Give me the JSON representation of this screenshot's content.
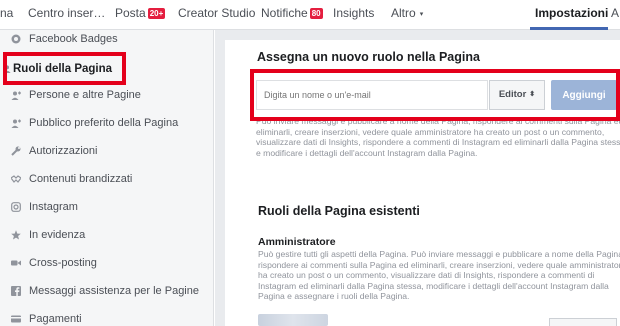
{
  "topnav": {
    "items": [
      {
        "label": "na"
      },
      {
        "label": "Centro inser…"
      },
      {
        "label": "Posta",
        "badge": "20+"
      },
      {
        "label": "Creator Studio"
      },
      {
        "label": "Notifiche",
        "badge": "80"
      },
      {
        "label": "Insights"
      },
      {
        "label": "Altro",
        "caret": "▾"
      },
      {
        "label": "Impostazioni",
        "active": true
      },
      {
        "label": "A"
      }
    ]
  },
  "sidebar": {
    "items": [
      {
        "label": "Facebook Badges",
        "icon": "badge-icon"
      },
      {
        "label": "Ruoli della Pagina",
        "icon": "person-icon",
        "selected": true
      },
      {
        "label": "Persone e altre Pagine",
        "icon": "people-icon"
      },
      {
        "label": "Pubblico preferito della Pagina",
        "icon": "people-icon"
      },
      {
        "label": "Autorizzazioni",
        "icon": "wrench-icon"
      },
      {
        "label": "Contenuti brandizzati",
        "icon": "handshake-icon"
      },
      {
        "label": "Instagram",
        "icon": "instagram-icon"
      },
      {
        "label": "In evidenza",
        "icon": "star-icon"
      },
      {
        "label": "Cross-posting",
        "icon": "video-icon"
      },
      {
        "label": "Messaggi assistenza per le Pagine",
        "icon": "facebook-icon"
      },
      {
        "label": "Pagamenti",
        "icon": "payment-icon"
      }
    ]
  },
  "assign": {
    "title": "Assegna un nuovo ruolo nella Pagina",
    "input_placeholder": "Digita un nome o un'e-mail",
    "role_value": "Editor",
    "role_arrow": "⬍",
    "add_label": "Aggiungi",
    "description_lines": [
      "Può inviare messaggi e pubblicare a nome della Pagina, rispondere ai commenti sulla Pagina ed",
      "eliminarli, creare inserzioni, vedere quale amministratore ha creato un post o un commento,",
      "visualizzare dati di Insights, rispondere a commenti di Instagram ed eliminarli dalla Pagina stessa",
      "e modificare i dettagli dell'account Instagram dalla Pagina."
    ]
  },
  "existing": {
    "title": "Ruoli della Pagina esistenti",
    "admin_heading": "Amministratore",
    "admin_description_lines": [
      "Può gestire tutti gli aspetti della Pagina. Può inviare messaggi e pubblicare a nome della Pagina,",
      "rispondere ai commenti sulla Pagina ed eliminarli, creare inserzioni, vedere quale amministratore",
      "ha creato un post o un commento, visualizzare dati di Insights, rispondere a commenti di",
      "Instagram ed eliminarli dalla Pagina stessa, modificare i dettagli dell'account Instagram dalla",
      "Pagina e assegnare i ruoli della Pagina."
    ]
  },
  "colors": {
    "highlight": "#e4001b",
    "accent": "#4267b2",
    "badge": "#e41e3f",
    "add_button": "#9cb4d8"
  }
}
